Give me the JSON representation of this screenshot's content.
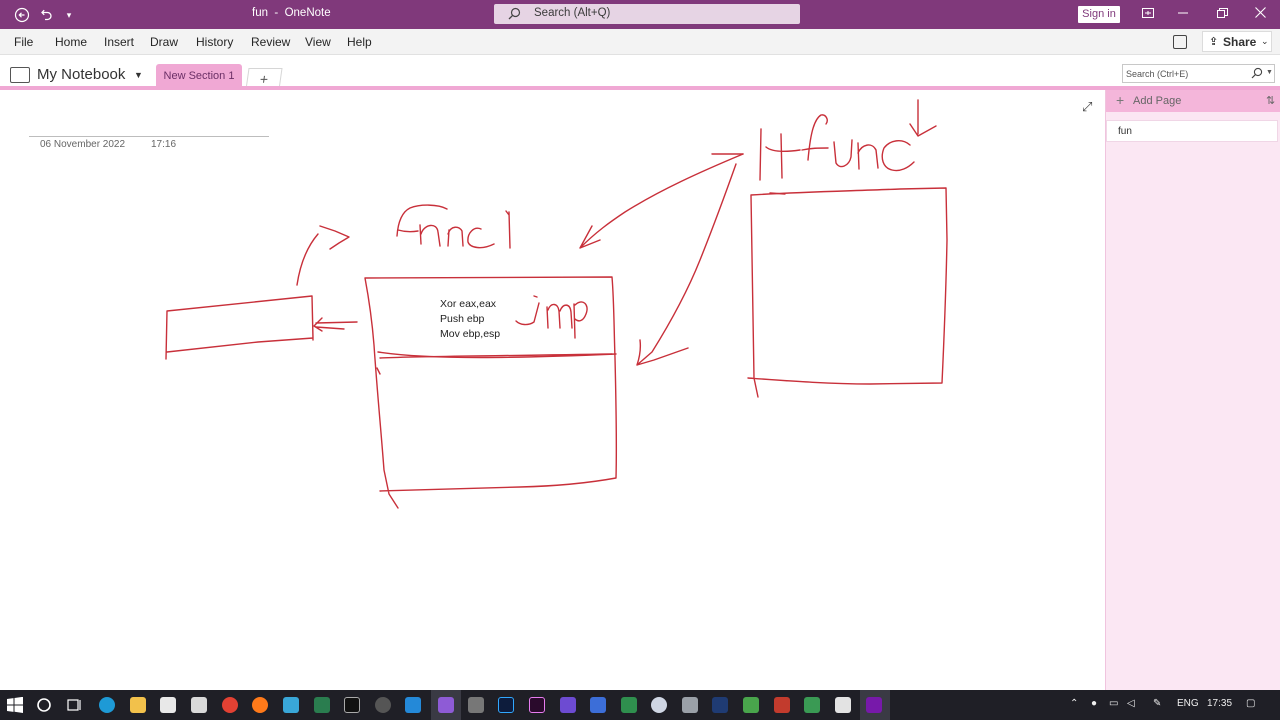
{
  "window": {
    "title": "fun  -  OneNote",
    "search_placeholder": "Search (Alt+Q)",
    "sign_in": "Sign in"
  },
  "ribbon": {
    "tabs": [
      "File",
      "Home",
      "Insert",
      "Draw",
      "History",
      "Review",
      "View",
      "Help"
    ],
    "share_label": "Share"
  },
  "notebook": {
    "name": "My Notebook",
    "section_tab": "New Section 1",
    "add_section": "+",
    "find_placeholder": "Search (Ctrl+E)"
  },
  "page": {
    "date": "06 November 2022",
    "time": "17:16",
    "code_lines": [
      "Xor eax,eax",
      "Push ebp",
      "Mov ebp,esp"
    ]
  },
  "page_pane": {
    "add_page": "Add Page",
    "pages": [
      "fun"
    ]
  },
  "taskbar": {
    "language": "ENG",
    "clock": "17:35"
  },
  "colors": {
    "title_bar": "#80397b",
    "section_tab": "#f0a8d4",
    "ink": "#c8303a"
  }
}
